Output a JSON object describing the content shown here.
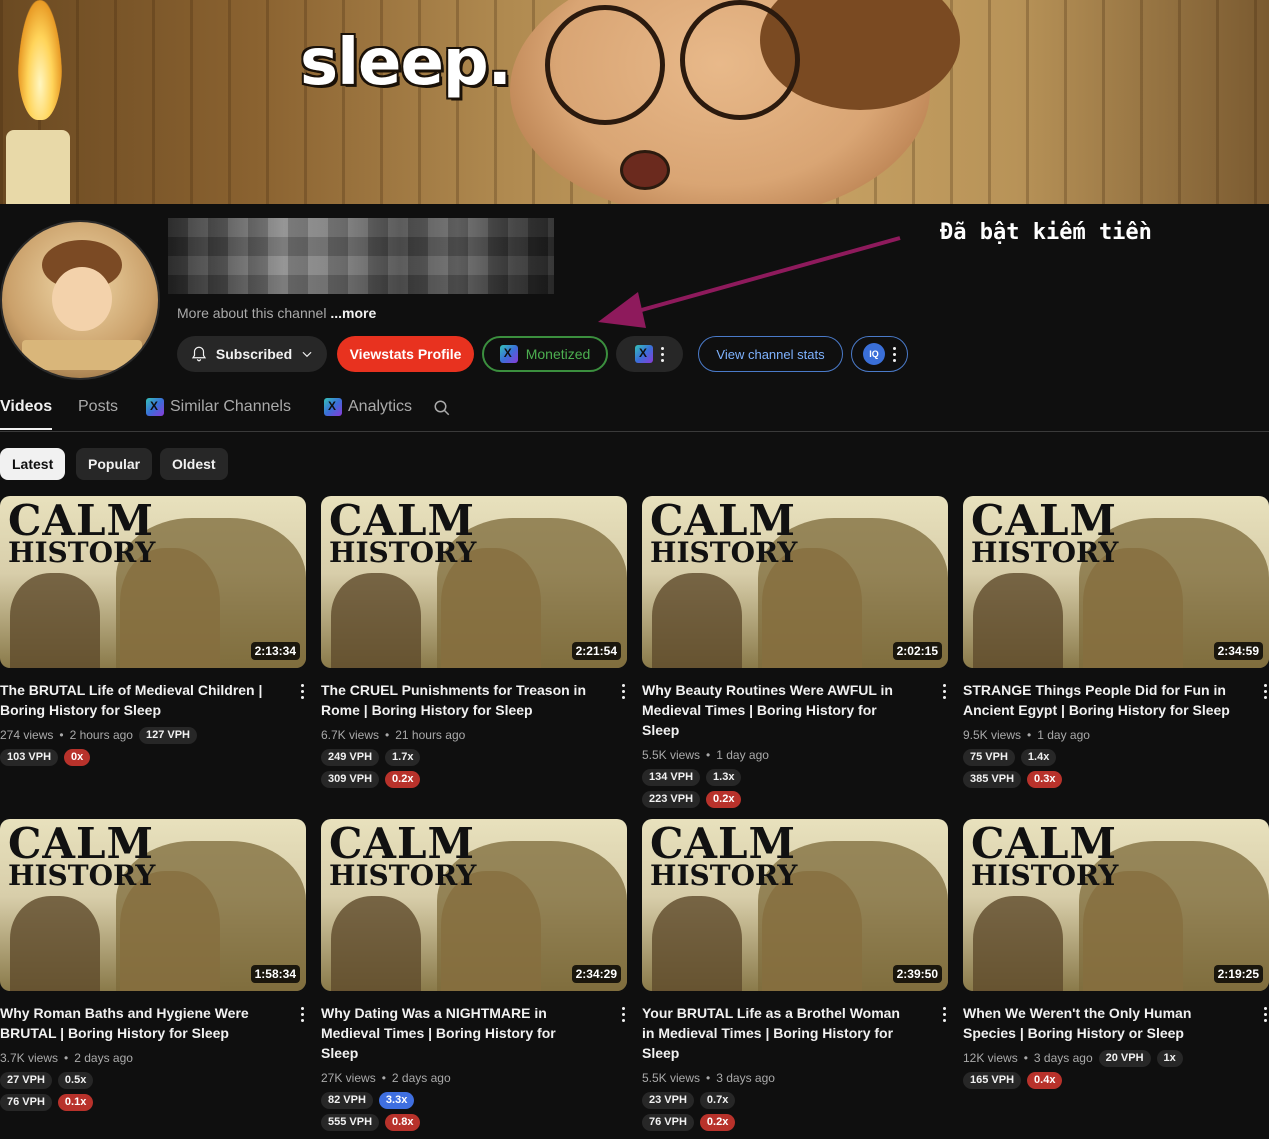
{
  "banner": {
    "title": "sleep."
  },
  "channel": {
    "more_about": "More about this channel",
    "more_link": "...more",
    "annotation": "Đã bật kiếm tiền"
  },
  "buttons": {
    "subscribed": "Subscribed",
    "viewstats_profile": "Viewstats Profile",
    "monetized": "Monetized",
    "view_channel_stats": "View channel stats",
    "iq_badge": "IQ"
  },
  "tabs": [
    {
      "label": "Videos"
    },
    {
      "label": "Posts"
    },
    {
      "label": "Similar Channels"
    },
    {
      "label": "Analytics"
    }
  ],
  "chips": [
    "Latest",
    "Popular",
    "Oldest"
  ],
  "thumb_brand": {
    "line1": "CALM",
    "line2": "HISTORY"
  },
  "videos": [
    {
      "title": "The BRUTAL Life of Medieval Children | Boring History for Sleep",
      "duration": "2:13:34",
      "views": "274 views",
      "age": "2 hours ago",
      "row1": [],
      "inline_pill": "127 VPH",
      "row2": [
        "103 VPH",
        "0x"
      ]
    },
    {
      "title": "The CRUEL Punishments for Treason in Rome | Boring History for Sleep",
      "duration": "2:21:54",
      "views": "6.7K views",
      "age": "21 hours ago",
      "row1": [
        "249 VPH",
        "1.7x"
      ],
      "inline_pill": "",
      "row2": [
        "309 VPH",
        "0.2x"
      ]
    },
    {
      "title": "Why Beauty Routines Were AWFUL in Medieval Times | Boring History for Sleep",
      "duration": "2:02:15",
      "views": "5.5K views",
      "age": "1 day ago",
      "row1": [
        "134 VPH",
        "1.3x"
      ],
      "inline_pill": "",
      "row2": [
        "223 VPH",
        "0.2x"
      ]
    },
    {
      "title": "STRANGE Things People Did for Fun in Ancient Egypt | Boring History for Sleep",
      "duration": "2:34:59",
      "views": "9.5K views",
      "age": "1 day ago",
      "row1": [
        "75 VPH",
        "1.4x"
      ],
      "inline_pill": "",
      "row2": [
        "385 VPH",
        "0.3x"
      ]
    },
    {
      "title": "Why Roman Baths and Hygiene Were BRUTAL | Boring History for Sleep",
      "duration": "1:58:34",
      "views": "3.7K views",
      "age": "2 days ago",
      "row1": [
        "27 VPH",
        "0.5x"
      ],
      "inline_pill": "",
      "row2": [
        "76 VPH",
        "0.1x"
      ]
    },
    {
      "title": "Why Dating Was a NIGHTMARE in Medieval Times | Boring History for Sleep",
      "duration": "2:34:29",
      "views": "27K views",
      "age": "2 days ago",
      "row1": [
        "82 VPH",
        "3.3x"
      ],
      "inline_pill": "",
      "row2": [
        "555 VPH",
        "0.8x"
      ]
    },
    {
      "title": "Your BRUTAL Life as a Brothel Woman in Medieval Times | Boring History for Sleep",
      "duration": "2:39:50",
      "views": "5.5K views",
      "age": "3 days ago",
      "row1": [
        "23 VPH",
        "0.7x"
      ],
      "inline_pill": "",
      "row2": [
        "76 VPH",
        "0.2x"
      ]
    },
    {
      "title": "When We Weren't the Only Human Species | Boring History or Sleep",
      "duration": "2:19:25",
      "views": "12K views",
      "age": "3 days ago",
      "row1": [],
      "inline_pill": "20 VPH",
      "inline_pill2": "1x",
      "row2": [
        "165 VPH",
        "0.4x"
      ]
    }
  ],
  "colors": {
    "red_pill": "#b8322b",
    "blue_pill": "#3f6fe0",
    "monetized_green": "#4caf50",
    "arrow": "#8e1a5c"
  }
}
